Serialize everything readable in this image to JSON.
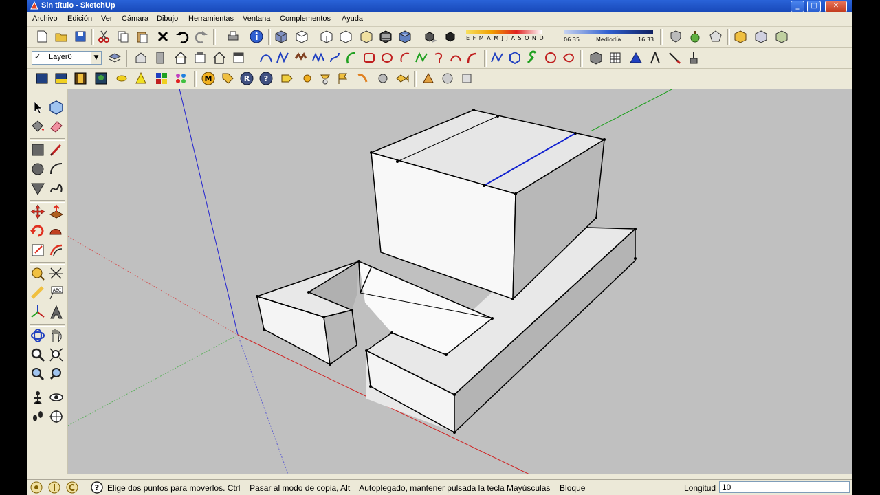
{
  "window": {
    "title": "Sin título - SketchUp",
    "min_label": "_",
    "max_label": "□",
    "close_label": "✕"
  },
  "menu": [
    "Archivo",
    "Edición",
    "Ver",
    "Cámara",
    "Dibujo",
    "Herramientas",
    "Ventana",
    "Complementos",
    "Ayuda"
  ],
  "layers": {
    "checkmark": "✓",
    "current_layer": "Layer0",
    "dropdown_arrow": "▼"
  },
  "shadows": {
    "months": "E F M A M J J A S O N D",
    "time_start": "06:35",
    "midday": "Mediodía",
    "time_end": "16:33"
  },
  "status": {
    "hint": "Elige dos puntos para moverlos. Ctrl = Pasar al modo de copia, Alt = Autoplegado, mantener pulsada la tecla Mayúsculas = Bloque",
    "measure_label": "Longitud",
    "measure_value": "10"
  },
  "icons": {
    "app": "sketchup-icon",
    "help": "question-icon"
  },
  "colors": {
    "titlebar": "#1848b8",
    "chrome": "#ece9d8",
    "viewport": "#c0c0c0",
    "axis_red": "#d02020",
    "axis_green": "#20a020",
    "axis_blue": "#2020d0"
  }
}
